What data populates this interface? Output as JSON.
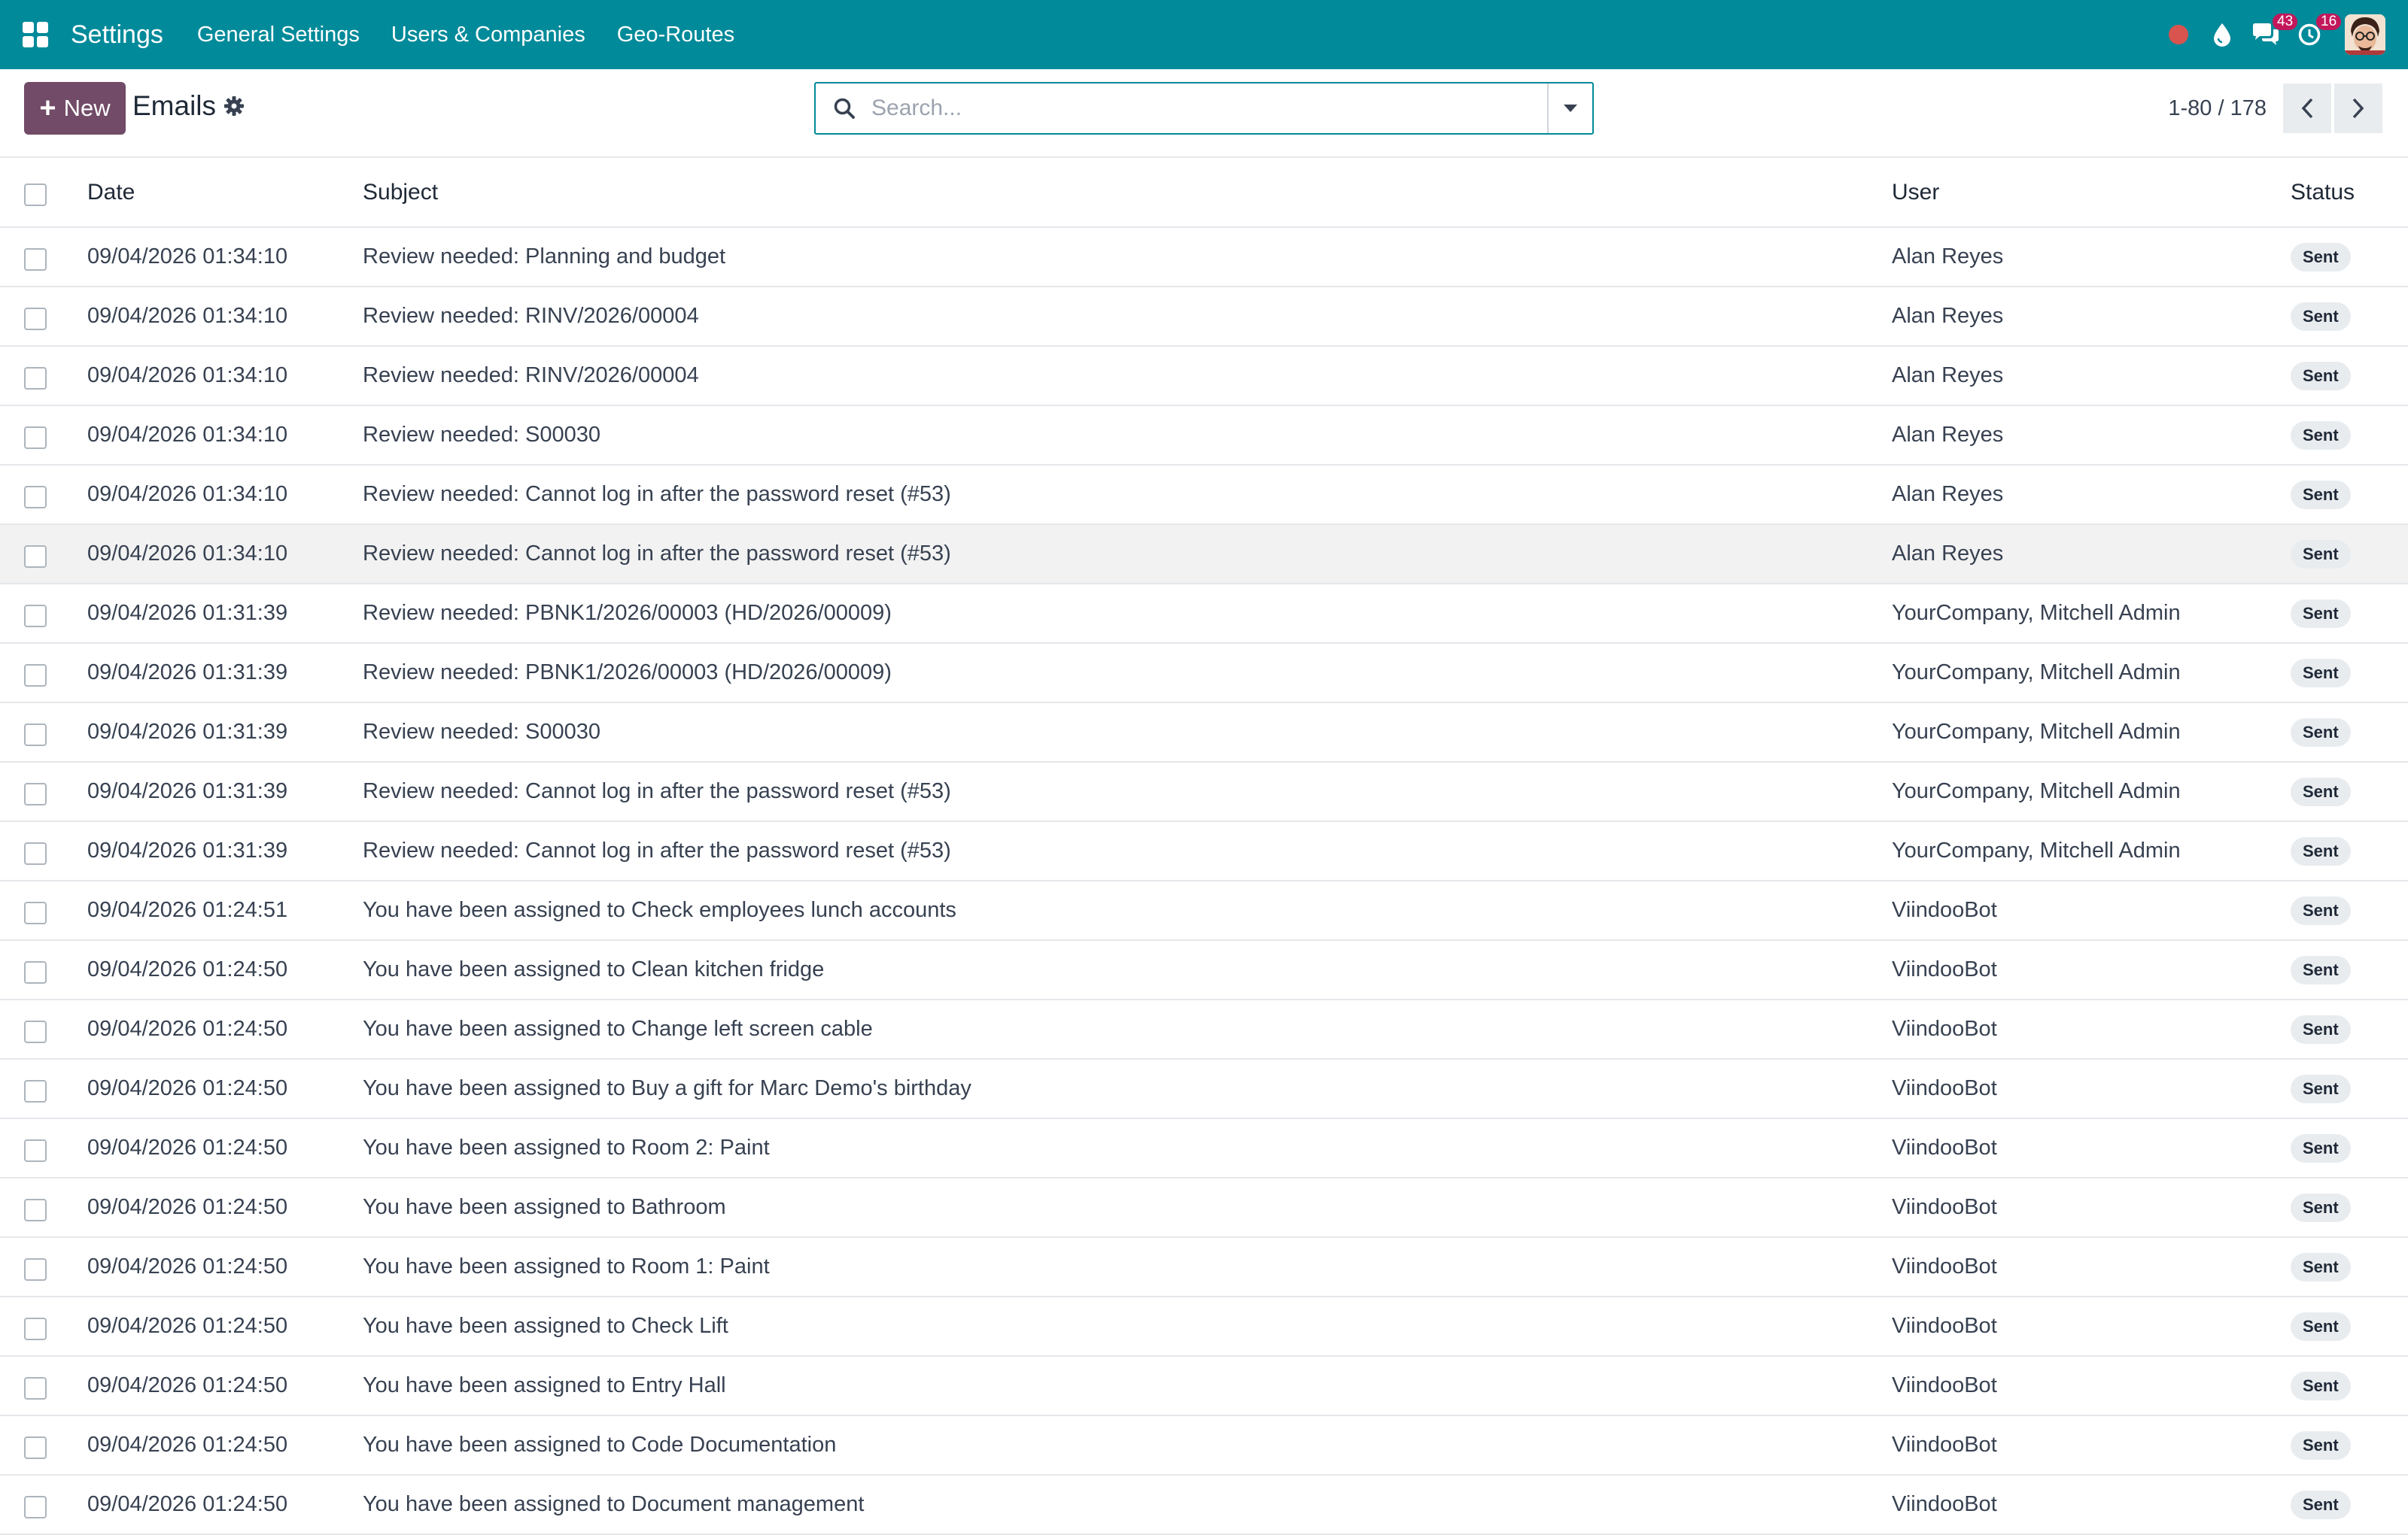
{
  "navbar": {
    "brand": "Settings",
    "menu": [
      "General Settings",
      "Users & Companies",
      "Geo-Routes"
    ],
    "messages_count": "43",
    "activities_count": "16"
  },
  "control": {
    "new_label": "New",
    "title": "Emails",
    "search_placeholder": "Search...",
    "pager_value": "1-80 / 178"
  },
  "table": {
    "headers": {
      "date": "Date",
      "subject": "Subject",
      "user": "User",
      "status": "Status"
    },
    "rows": [
      {
        "date": "09/04/2026 01:34:10",
        "subject": "Review needed: Planning and budget",
        "user": "Alan Reyes",
        "status": "Sent"
      },
      {
        "date": "09/04/2026 01:34:10",
        "subject": "Review needed: RINV/2026/00004",
        "user": "Alan Reyes",
        "status": "Sent"
      },
      {
        "date": "09/04/2026 01:34:10",
        "subject": "Review needed: RINV/2026/00004",
        "user": "Alan Reyes",
        "status": "Sent"
      },
      {
        "date": "09/04/2026 01:34:10",
        "subject": "Review needed: S00030",
        "user": "Alan Reyes",
        "status": "Sent"
      },
      {
        "date": "09/04/2026 01:34:10",
        "subject": "Review needed: Cannot log in after the password reset (#53)",
        "user": "Alan Reyes",
        "status": "Sent"
      },
      {
        "date": "09/04/2026 01:34:10",
        "subject": "Review needed: Cannot log in after the password reset (#53)",
        "user": "Alan Reyes",
        "status": "Sent"
      },
      {
        "date": "09/04/2026 01:31:39",
        "subject": "Review needed: PBNK1/2026/00003 (HD/2026/00009)",
        "user": "YourCompany, Mitchell Admin",
        "status": "Sent"
      },
      {
        "date": "09/04/2026 01:31:39",
        "subject": "Review needed: PBNK1/2026/00003 (HD/2026/00009)",
        "user": "YourCompany, Mitchell Admin",
        "status": "Sent"
      },
      {
        "date": "09/04/2026 01:31:39",
        "subject": "Review needed: S00030",
        "user": "YourCompany, Mitchell Admin",
        "status": "Sent"
      },
      {
        "date": "09/04/2026 01:31:39",
        "subject": "Review needed: Cannot log in after the password reset (#53)",
        "user": "YourCompany, Mitchell Admin",
        "status": "Sent"
      },
      {
        "date": "09/04/2026 01:31:39",
        "subject": "Review needed: Cannot log in after the password reset (#53)",
        "user": "YourCompany, Mitchell Admin",
        "status": "Sent"
      },
      {
        "date": "09/04/2026 01:24:51",
        "subject": "You have been assigned to Check employees lunch accounts",
        "user": "ViindooBot",
        "status": "Sent"
      },
      {
        "date": "09/04/2026 01:24:50",
        "subject": "You have been assigned to Clean kitchen fridge",
        "user": "ViindooBot",
        "status": "Sent"
      },
      {
        "date": "09/04/2026 01:24:50",
        "subject": "You have been assigned to Change left screen cable",
        "user": "ViindooBot",
        "status": "Sent"
      },
      {
        "date": "09/04/2026 01:24:50",
        "subject": "You have been assigned to Buy a gift for Marc Demo's birthday",
        "user": "ViindooBot",
        "status": "Sent"
      },
      {
        "date": "09/04/2026 01:24:50",
        "subject": "You have been assigned to Room 2: Paint",
        "user": "ViindooBot",
        "status": "Sent"
      },
      {
        "date": "09/04/2026 01:24:50",
        "subject": "You have been assigned to Bathroom",
        "user": "ViindooBot",
        "status": "Sent"
      },
      {
        "date": "09/04/2026 01:24:50",
        "subject": "You have been assigned to Room 1: Paint",
        "user": "ViindooBot",
        "status": "Sent"
      },
      {
        "date": "09/04/2026 01:24:50",
        "subject": "You have been assigned to Check Lift",
        "user": "ViindooBot",
        "status": "Sent"
      },
      {
        "date": "09/04/2026 01:24:50",
        "subject": "You have been assigned to Entry Hall",
        "user": "ViindooBot",
        "status": "Sent"
      },
      {
        "date": "09/04/2026 01:24:50",
        "subject": "You have been assigned to Code Documentation",
        "user": "ViindooBot",
        "status": "Sent"
      },
      {
        "date": "09/04/2026 01:24:50",
        "subject": "You have been assigned to Document management",
        "user": "ViindooBot",
        "status": "Sent"
      }
    ]
  },
  "colors": {
    "navbar": "#018a9a",
    "primary_button": "#714b67",
    "badge": "#c2185b",
    "recording_dot": "#d9534f"
  }
}
